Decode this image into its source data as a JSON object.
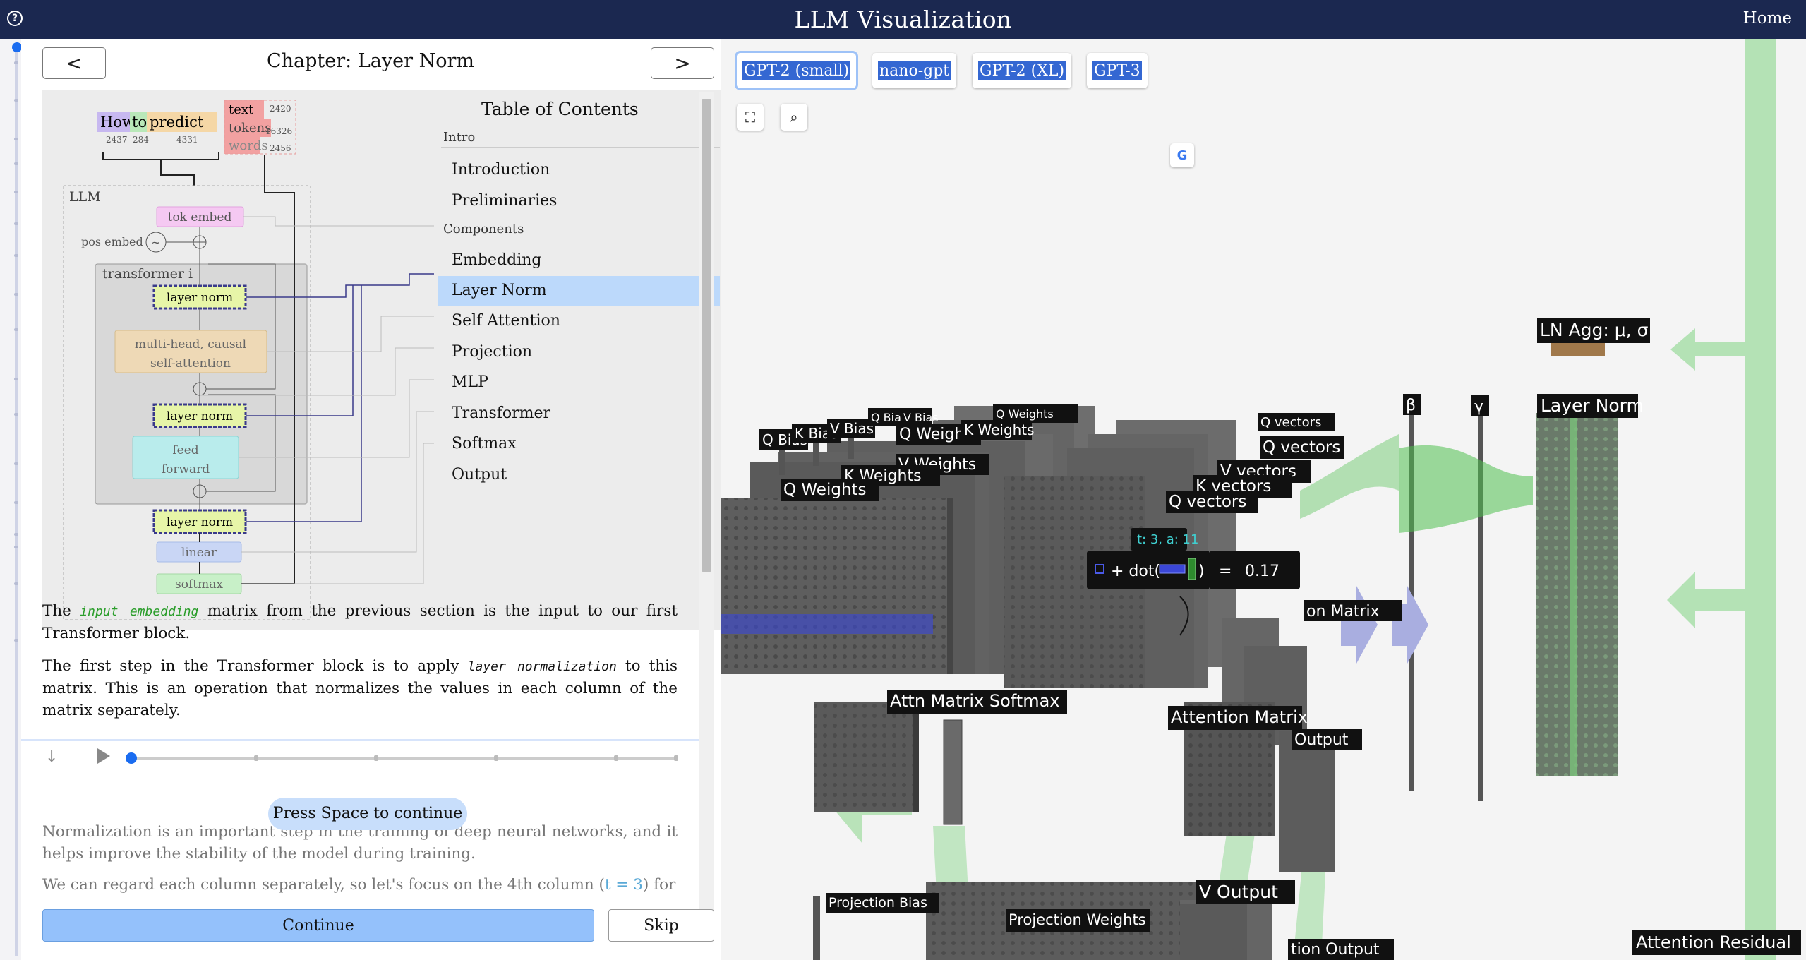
{
  "app": {
    "title": "LLM Visualization",
    "home": "Home",
    "help_icon": "?"
  },
  "chapter": {
    "title": "Chapter: Layer Norm",
    "prev": "<",
    "next": ">"
  },
  "diagram": {
    "tokens": [
      {
        "word": "How",
        "id": "2437",
        "color": "#c7b8f0"
      },
      {
        "word": "to",
        "id": "284",
        "color": "#b9e8b9"
      },
      {
        "word": "predict",
        "id": "4331",
        "color": "#f5d7a6"
      }
    ],
    "legend": {
      "text": "text",
      "tokens": "tokens",
      "words": "words",
      "n1": "2420",
      "n2": "16326",
      "n3": "2456"
    },
    "llm": "LLM",
    "tok_embed": "tok embed",
    "pos_embed": "pos embed",
    "pos_embed_symbol": "~",
    "transformer": "transformer i",
    "layer_norm": "layer norm",
    "attention_1": "multi-head, causal",
    "attention_2": "self-attention",
    "ff_1": "feed",
    "ff_2": "forward",
    "linear": "linear",
    "softmax": "softmax"
  },
  "toc": {
    "title": "Table of Contents",
    "sections": [
      {
        "name": "Intro",
        "items": [
          "Introduction",
          "Preliminaries"
        ]
      },
      {
        "name": "Components",
        "items": [
          "Embedding",
          "Layer Norm",
          "Self Attention",
          "Projection",
          "MLP",
          "Transformer",
          "Softmax",
          "Output"
        ]
      }
    ],
    "active": "Layer Norm"
  },
  "text": {
    "p1_a": "The ",
    "p1_em": "input embedding",
    "p1_b": " matrix from the previous section is the input to our first Transformer block.",
    "p2_a": "The first step in the Transformer block is to apply ",
    "p2_em": "layer normalization",
    "p2_b": " to this matrix. This is an operation that normalizes the values in each column of the matrix separately.",
    "p3": "Normalization is an important step in the training of deep neural networks, and it helps improve the stability of the model during training.",
    "p4_a": "We can regard each column separately, so let's focus on the 4th column (",
    "p4_em": "t = 3",
    "p4_b": ") for"
  },
  "player": {
    "down_icon": "↓",
    "press_space": "Press Space to continue"
  },
  "buttons": {
    "continue": "Continue",
    "skip": "Skip"
  },
  "models": [
    "GPT-2 (small)",
    "nano-gpt",
    "GPT-2 (XL)",
    "GPT-3"
  ],
  "view_icons": {
    "expand": "⛶",
    "search": "⌕",
    "translate": "G"
  },
  "scene": {
    "labels": {
      "q_bias": "Q Bias",
      "k_bias": "K Bias",
      "v_bias": "V Bias",
      "q_weights": "Q Weights",
      "k_weights": "K Weights",
      "v_weights": "V Weights",
      "q_vectors": "Q vectors",
      "k_vectors": "K vectors",
      "v_vectors": "V vectors",
      "attn_softmax": "Attn Matrix Softmax",
      "attn_matrix": "Attention Matrix",
      "on_matrix": "on Matrix",
      "output": "Output",
      "proj_bias": "Projection Bias",
      "proj_weights": "Projection Weights",
      "v_output": "V Output",
      "tion_output": "tion Output",
      "ln_agg": "LN Agg: μ, σ",
      "layer_norm": "Layer Norm",
      "beta": "β",
      "gamma": "γ",
      "attention_residual": "Attention Residual"
    },
    "tooltip": {
      "header": "t: 3, a: 11",
      "formula": "+ dot(",
      "close": ")",
      "equals": "=",
      "value": "0.17"
    }
  }
}
